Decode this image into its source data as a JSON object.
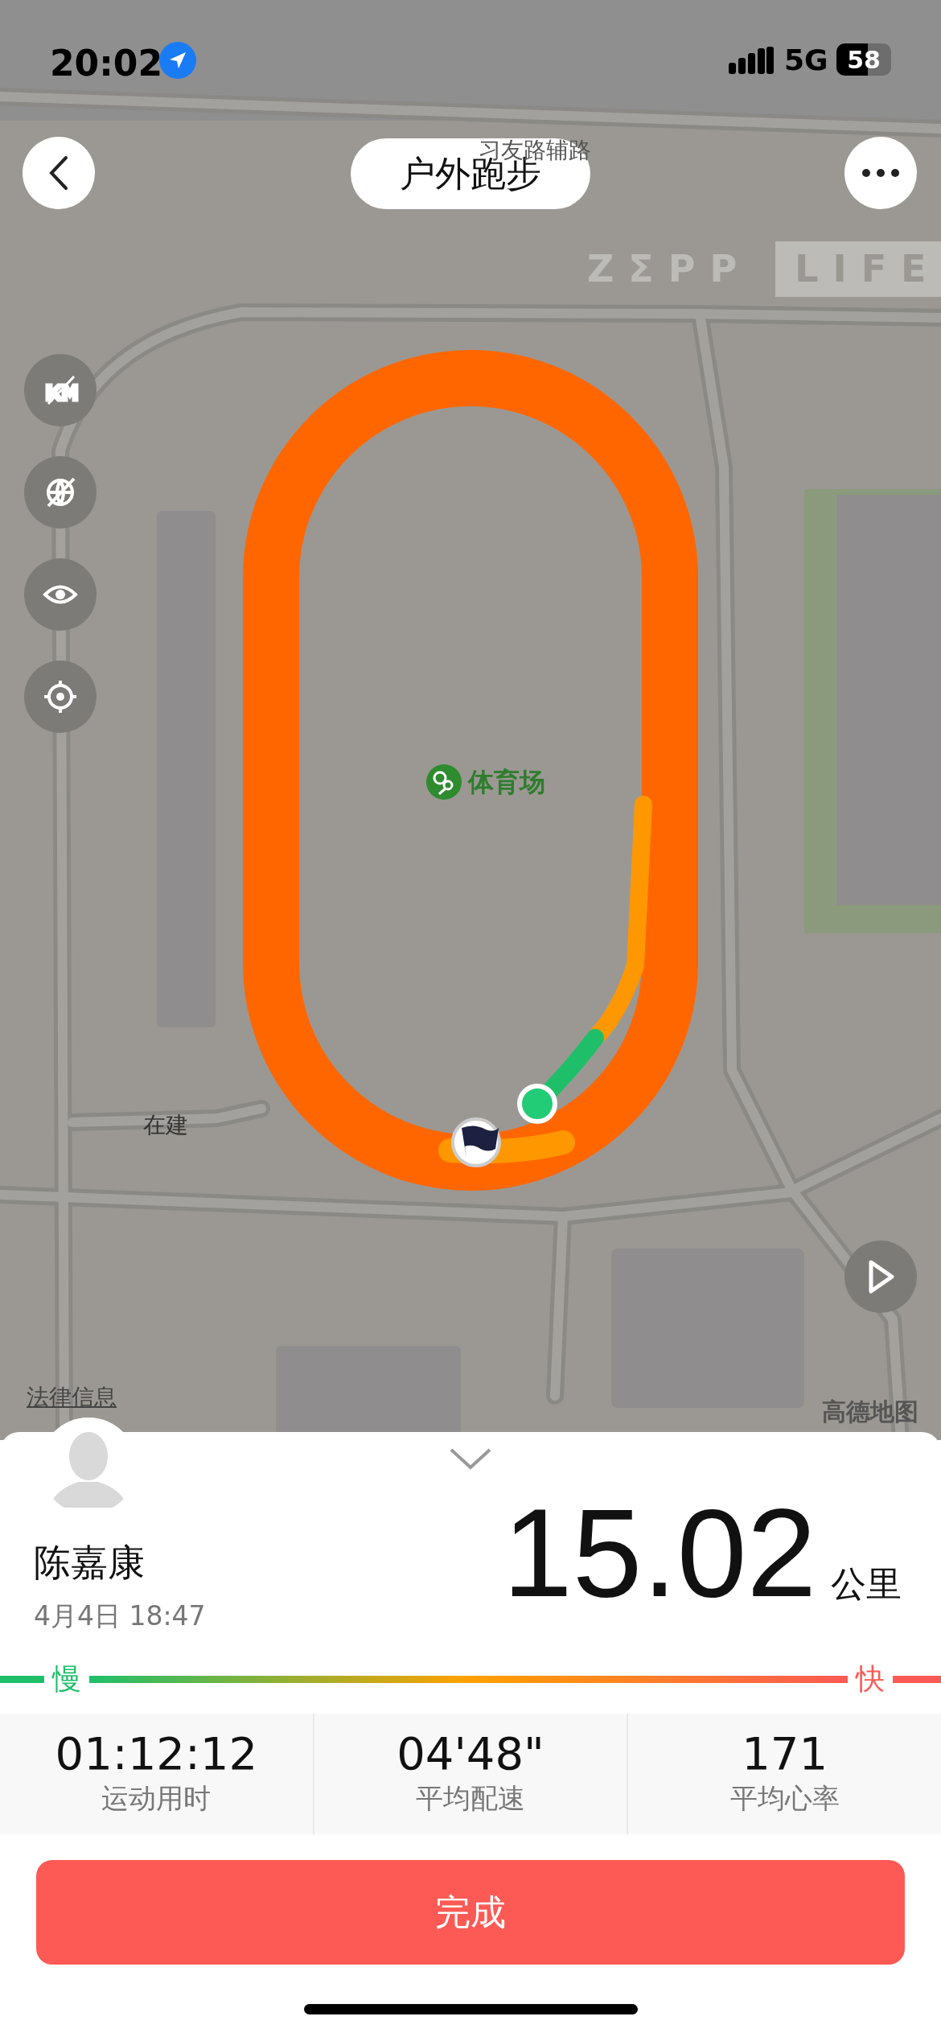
{
  "status_bar": {
    "time": "20:02",
    "network": "5G",
    "battery": "58"
  },
  "header": {
    "title": "户外跑步"
  },
  "map": {
    "logo": [
      "ZΣPP",
      "LIFE"
    ],
    "road_label": "习友路辅路",
    "poi": "体育场",
    "construction_label": "在建",
    "legal_link": "法律信息",
    "provider": "高德地图"
  },
  "sheet": {
    "name": "陈嘉康",
    "date": "4月4日 18:47",
    "distance": "15.02",
    "unit": "公里",
    "pace_legend": {
      "slow": "慢",
      "fast": "快"
    },
    "stats": [
      {
        "value": "01:12:12",
        "label": "运动用时"
      },
      {
        "value": "04'48\"",
        "label": "平均配速"
      },
      {
        "value": "171",
        "label": "平均心率"
      }
    ],
    "button": "完成"
  }
}
